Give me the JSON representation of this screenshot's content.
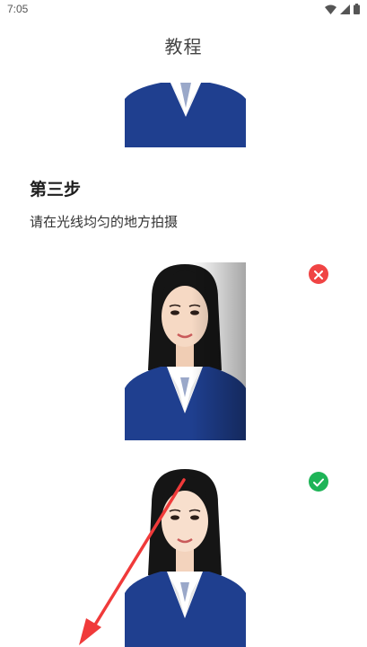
{
  "status_bar": {
    "time": "7:05",
    "icons": [
      "wifi-icon",
      "cellular-signal-icon",
      "battery-icon"
    ]
  },
  "header": {
    "title": "教程"
  },
  "step": {
    "heading": "第三步",
    "description": "请在光线均匀的地方拍摄"
  },
  "examples": [
    {
      "name": "uneven-light-example",
      "status": "wrong",
      "icon": "close-icon",
      "color": "#f04444"
    },
    {
      "name": "even-light-example",
      "status": "correct",
      "icon": "check-icon",
      "color": "#1eb457"
    }
  ],
  "colors": {
    "suit": "#1f3f8f",
    "wrong": "#f04444",
    "correct": "#1eb457",
    "annotation_arrow": "#f03a3a"
  }
}
